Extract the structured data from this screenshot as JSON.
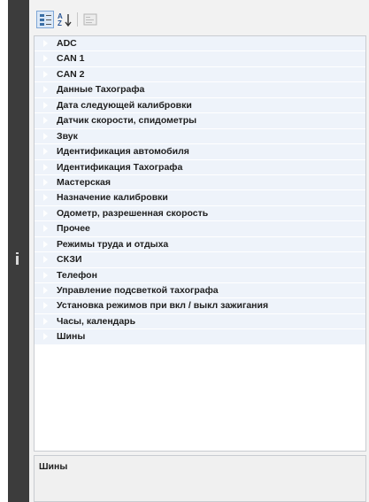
{
  "toolbar": {
    "categorized_icon": "categorized-view-icon",
    "alphabetical_icon": "sort-alphabetical-icon",
    "property_pages_icon": "property-pages-icon"
  },
  "categories": [
    "ADC",
    "CAN 1",
    "CAN 2",
    "Данные Тахографа",
    "Дата следующей калибровки",
    "Датчик скорости, спидометры",
    "Звук",
    "Идентификация автомобиля",
    "Идентификация Тахографа",
    "Мастерская",
    "Назначение калибровки",
    "Одометр, разрешенная скорость",
    "Прочее",
    "Режимы труда и отдыха",
    "СКЗИ",
    "Телефон",
    "Управление подсветкой тахографа",
    "Установка режимов при вкл / выкл зажигания",
    "Часы, календарь",
    "Шины"
  ],
  "description": {
    "title": "Шины"
  }
}
